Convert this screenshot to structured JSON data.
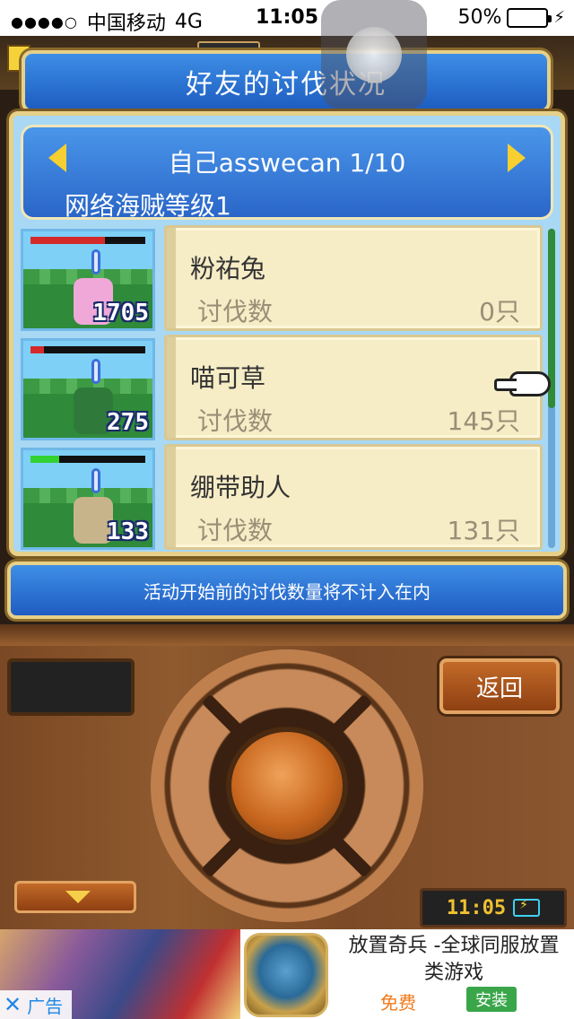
{
  "status_bar": {
    "signal_dots": "●●●●○",
    "carrier": "中国移动",
    "network": "4G",
    "time": "11:05",
    "battery_percent": "50%",
    "battery_level": 0.5
  },
  "title": "好友的讨伐状况",
  "header": {
    "player": "自己asswecan 1/10",
    "level": "网络海贼等级1"
  },
  "monsters": [
    {
      "name": "粉祐兔",
      "kill_label": "讨伐数",
      "kill_value": "0只",
      "portrait_count": "1705",
      "hp_fraction": 0.65,
      "hp_color": "#d42a2a",
      "figure_color": "#f0a8d8"
    },
    {
      "name": "喵可草",
      "kill_label": "讨伐数",
      "kill_value": "145只",
      "portrait_count": "275",
      "hp_fraction": 0.12,
      "hp_color": "#d42a2a",
      "figure_color": "#2f7a3a"
    },
    {
      "name": "绷带助人",
      "kill_label": "讨伐数",
      "kill_value": "131只",
      "portrait_count": "133",
      "hp_fraction": 0.25,
      "hp_color": "#32d232",
      "figure_color": "#c8b48a"
    }
  ],
  "notice": "活动开始前的讨伐数量将不计入在内",
  "controls": {
    "back_label": "返回",
    "clock_time": "11:05"
  },
  "ad": {
    "label": "广告",
    "title": "放置奇兵 -全球同服放置类游戏",
    "free_label": "免费",
    "install_label": "安装"
  },
  "colors": {
    "panel_blue": "#2a66c8",
    "card_cream": "#f6ecc6",
    "wood": "#8f5a2e",
    "accent_gold": "#e6d08a"
  }
}
